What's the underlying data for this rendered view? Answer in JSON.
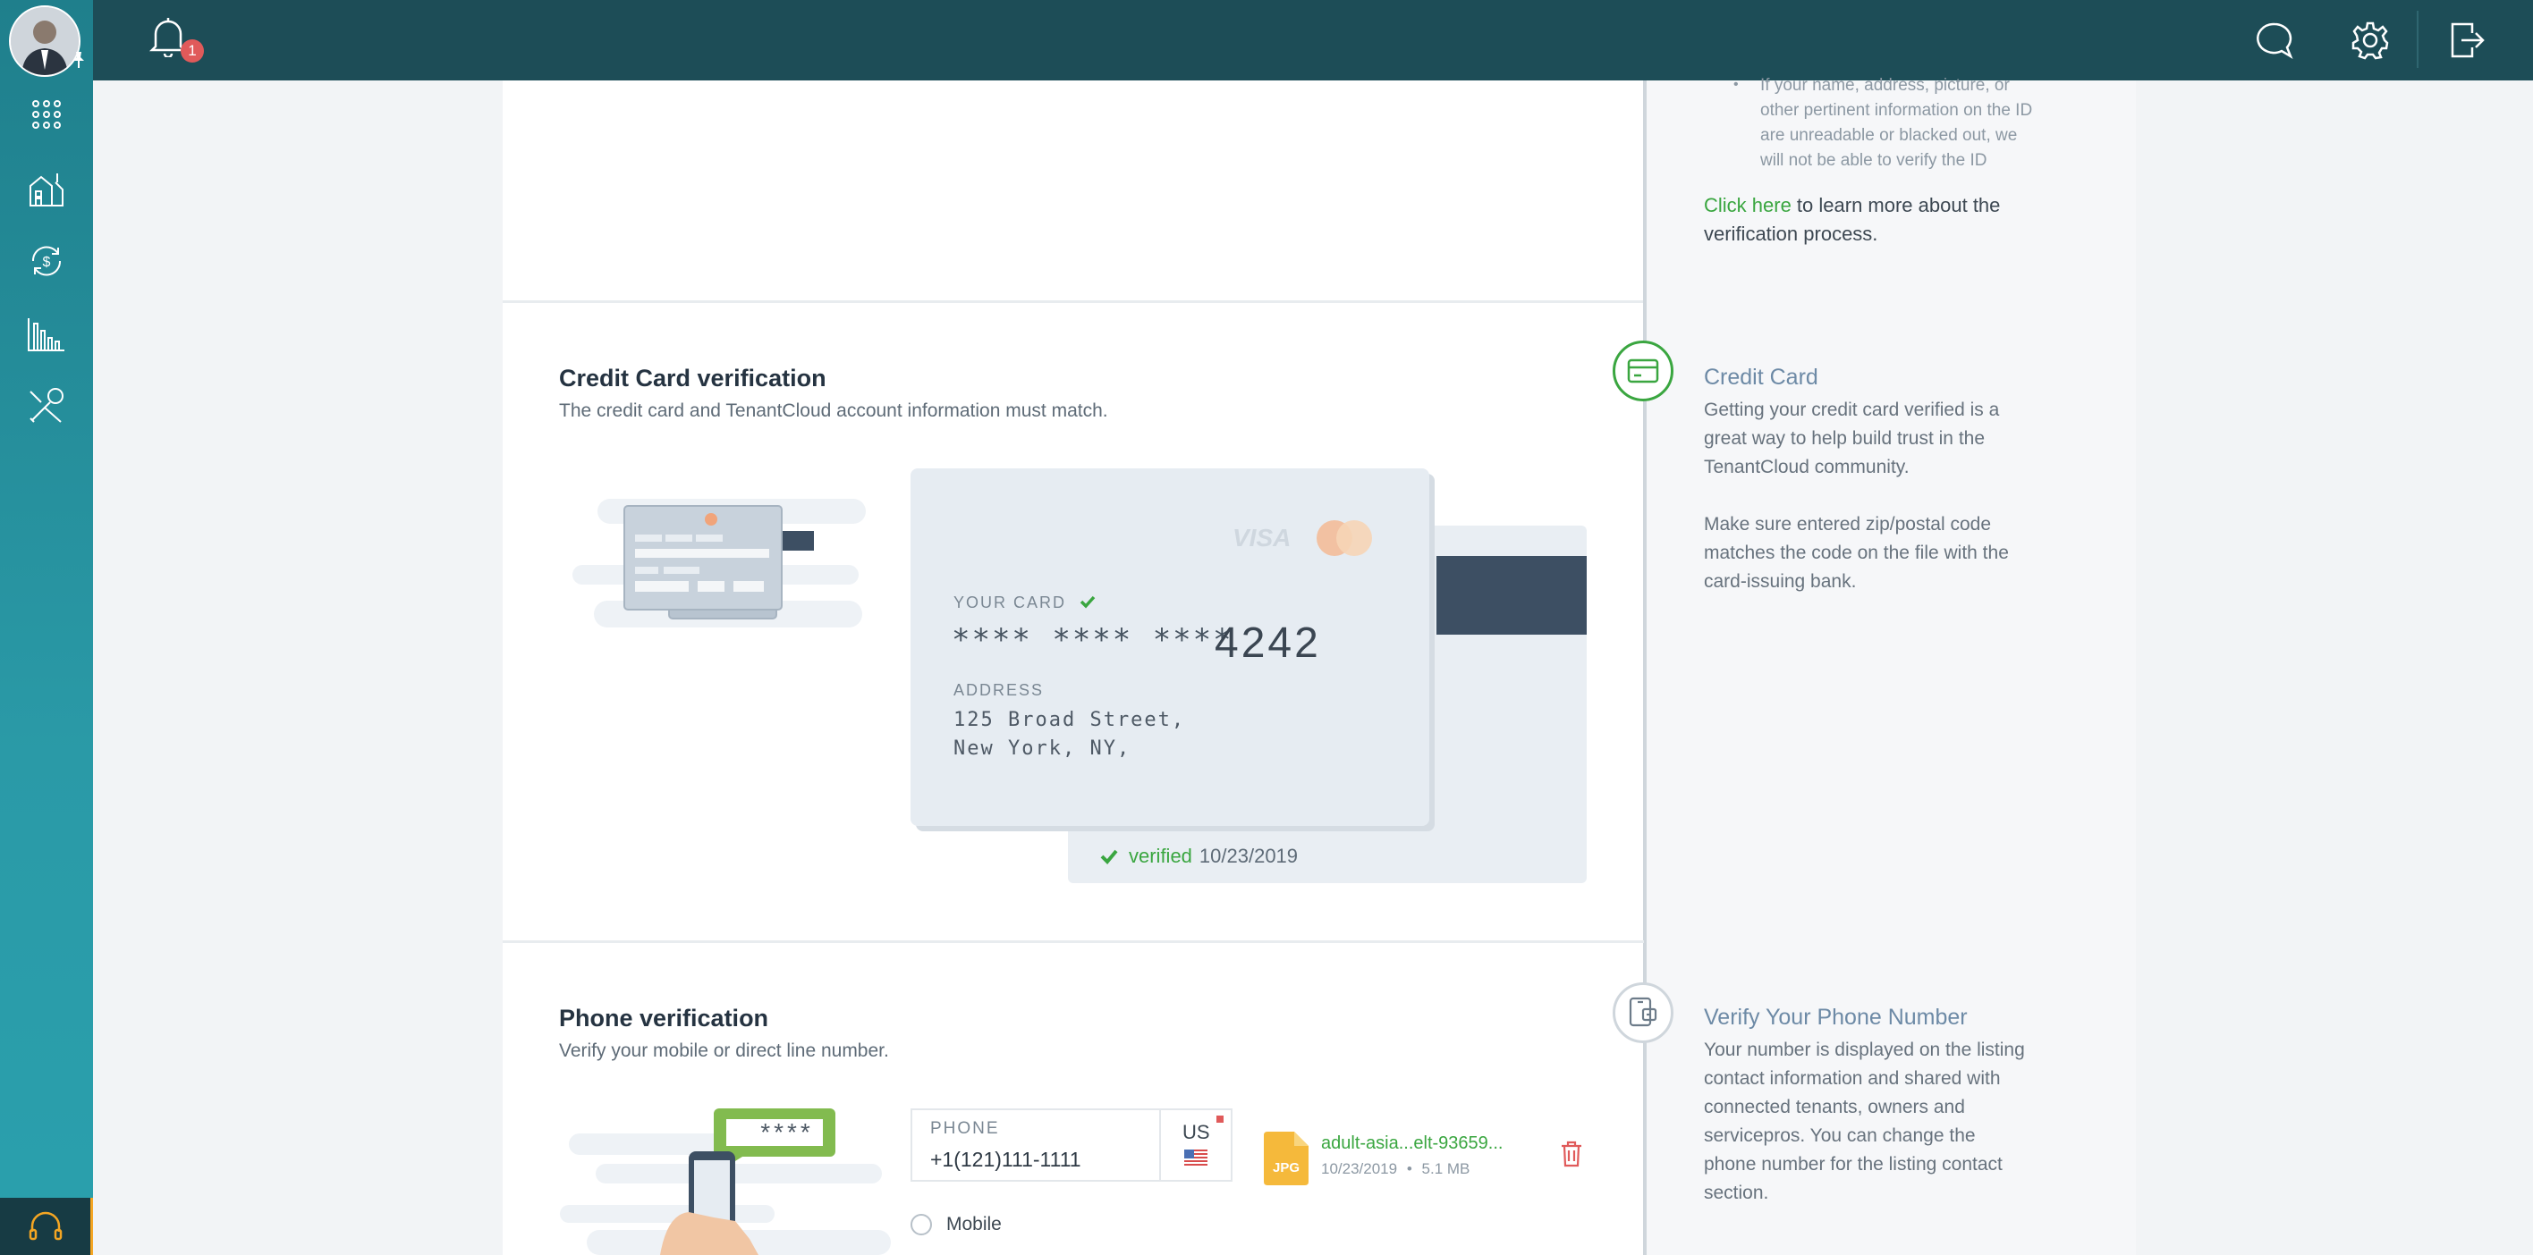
{
  "header": {
    "notification_count": "1"
  },
  "sidebar": {
    "items": [
      {
        "icon": "apps-grid-icon"
      },
      {
        "icon": "properties-icon"
      },
      {
        "icon": "accounting-icon"
      },
      {
        "icon": "reports-icon"
      },
      {
        "icon": "maintenance-tools-icon"
      }
    ]
  },
  "top_section": {
    "bullet_text": "If your name, address, picture, or other pertinent information on the ID are unreadable or blacked out, we will not be able to verify the ID",
    "bullet_lines": [
      "If your name, address, picture, or",
      "other pertinent information on the ID",
      "are unreadable or blacked out, we",
      "will not be able to verify the ID"
    ],
    "click_here": "Click here",
    "learn_more": " to learn more about the",
    "learn_more_2": "verification process."
  },
  "credit_card": {
    "title": "Credit Card verification",
    "subtitle": "The credit card and TenantCloud account information must match.",
    "your_card_label": "YOUR CARD",
    "masked_number": "**** **** ****",
    "last4": "4242",
    "address_label": "ADDRESS",
    "address_line1": "125 Broad Street,",
    "address_line2": "New York, NY,",
    "brand_visa": "VISA",
    "verified_label": "verified",
    "verified_date": "10/23/2019",
    "info_title": "Credit Card",
    "info_p1_lines": [
      "Getting your credit card verified is a",
      "great way to help build trust in the",
      "TenantCloud community."
    ],
    "info_p2_lines": [
      "Make sure entered zip/postal code",
      "matches the code on the file with the",
      "card-issuing bank."
    ]
  },
  "phone": {
    "title": "Phone verification",
    "subtitle": "Verify your mobile or direct line number.",
    "bubble_text": "****",
    "field_label": "PHONE",
    "field_value": "+1(121)111-1111",
    "country": "US",
    "file_type": "JPG",
    "file_name": "adult-asia...elt-93659...",
    "file_date": "10/23/2019",
    "file_size": "5.1 MB",
    "radio_mobile": "Mobile",
    "info_title": "Verify Your Phone Number",
    "info_lines": [
      "Your number is displayed on the listing",
      "contact information and shared with",
      "connected tenants, owners and",
      "servicepros. You can change the",
      "phone number for the listing contact",
      "section."
    ]
  },
  "colors": {
    "topbar": "#1d4d57",
    "sidebar": "#2a9aa7",
    "accent_green": "#3aa640",
    "badge_red": "#e05a5a"
  }
}
